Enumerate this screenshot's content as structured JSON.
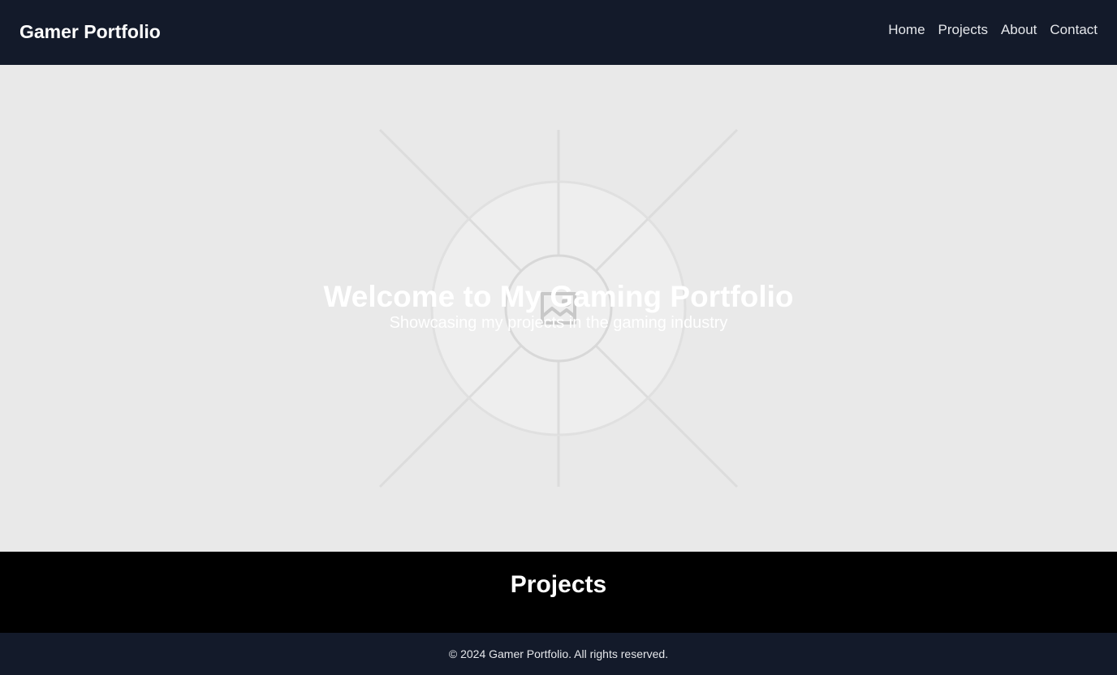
{
  "header": {
    "brand": "Gamer Portfolio",
    "nav": [
      {
        "label": "Home"
      },
      {
        "label": "Projects"
      },
      {
        "label": "About"
      },
      {
        "label": "Contact"
      }
    ]
  },
  "hero": {
    "title": "Welcome to My Gaming Portfolio",
    "subtitle": "Showcasing my projects in the gaming industry",
    "background_icon": "broken-image-icon"
  },
  "projects": {
    "title": "Projects"
  },
  "footer": {
    "text": "© 2024 Gamer Portfolio. All rights reserved."
  },
  "colors": {
    "header_bg": "#131a2a",
    "hero_bg": "#e9e9e9",
    "section_bg": "#000000",
    "text_light": "#ffffff"
  }
}
